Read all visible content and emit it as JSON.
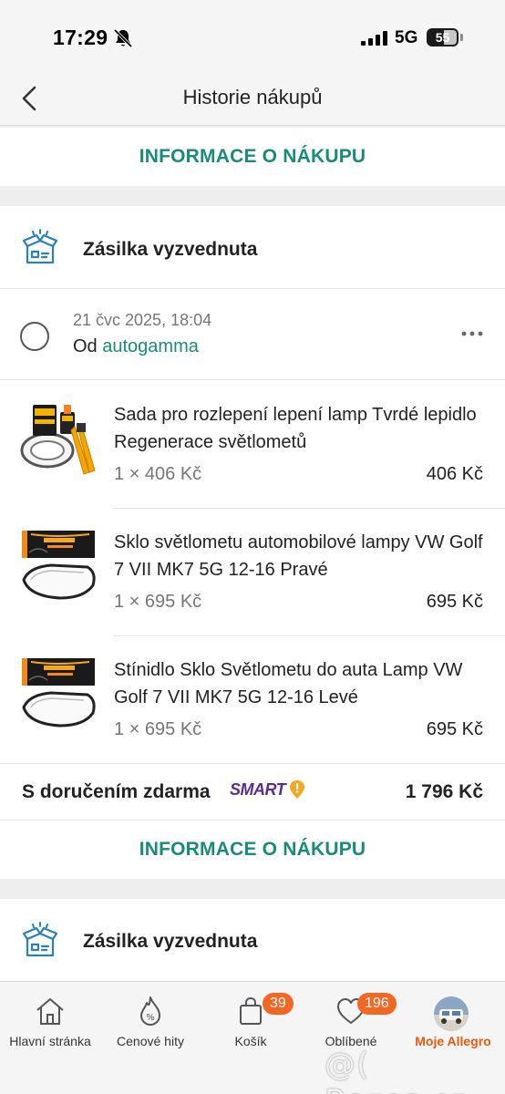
{
  "status_bar": {
    "time": "17:29",
    "network": "5G",
    "battery": "55"
  },
  "header": {
    "title": "Historie nákupů"
  },
  "top_link": {
    "label": "INFORMACE O NÁKUPU"
  },
  "shipment": {
    "status": "Zásilka vyzvednuta"
  },
  "order": {
    "date": "21 čvc 2025, 18:04",
    "from_prefix": "Od",
    "seller": "autogamma"
  },
  "items": [
    {
      "name": "Sada pro rozlepení lepení lamp Tvrdé lepidlo Regenerace světlometů",
      "qty": "1 × 406 Kč",
      "price": "406 Kč"
    },
    {
      "name": "Sklo světlometu automobilové lampy VW Golf 7 VII MK7 5G 12-16 Pravé",
      "qty": "1 × 695 Kč",
      "price": "695 Kč"
    },
    {
      "name": "Stínidlo Sklo Světlometu do auta Lamp VW Golf 7 VII MK7 5G 12-16 Levé",
      "qty": "1 × 695 Kč",
      "price": "695 Kč"
    }
  ],
  "summary": {
    "delivery": "S doručením zdarma",
    "smart_label": "SMART",
    "total": "1 796 Kč"
  },
  "info_link": {
    "label": "INFORMACE O NÁKUPU"
  },
  "next_shipment": {
    "status": "Zásilka vyzvednuta"
  },
  "nav": {
    "home": "Hlavní stránka",
    "prices": "Cenové hity",
    "cart": "Košík",
    "cart_badge": "39",
    "favorites": "Oblíbené",
    "favorites_badge": "196",
    "my_allegro": "Moje Allegro"
  },
  "watermark": "@( Bazos.cz",
  "colors": {
    "accent": "#1a8a7a",
    "badge": "#f26722",
    "smart": "#5b2d8e",
    "active_nav": "#e8590c"
  }
}
